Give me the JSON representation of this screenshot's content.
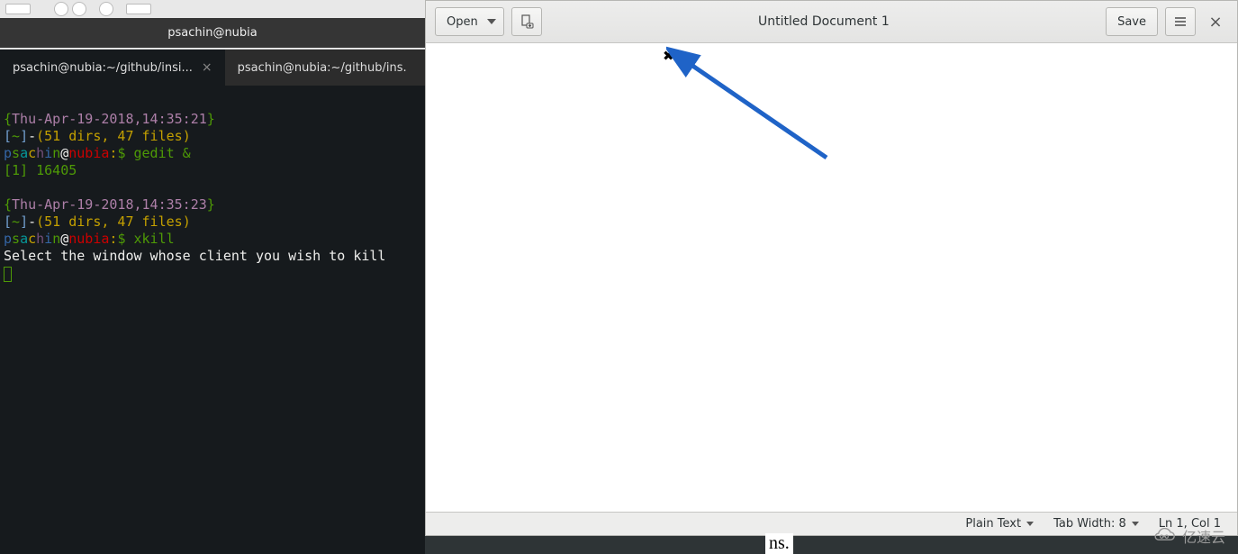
{
  "browser_fragment": {
    "title": "psachin@nubia"
  },
  "terminal": {
    "tabs": [
      {
        "label": "psachin@nubia:~/github/insi...",
        "active": true
      },
      {
        "label": "psachin@nubia:~/github/ins.",
        "active": false
      }
    ],
    "block1": {
      "timestamp": "Thu-Apr-19-2018,14:35:21",
      "stats": "51 dirs, 47 files",
      "host": "nubia",
      "command": "gedit &",
      "job": "[1]",
      "pid": "16405"
    },
    "block2": {
      "timestamp": "Thu-Apr-19-2018,14:35:23",
      "stats": "51 dirs, 47 files",
      "host": "nubia",
      "command": "xkill",
      "message": "Select the window whose client you wish to kill"
    }
  },
  "gedit": {
    "open_label": "Open",
    "save_label": "Save",
    "title": "Untitled Document 1",
    "status": {
      "language": "Plain Text",
      "tab_width": "Tab Width: 8",
      "position": "Ln 1, Col 1"
    }
  },
  "xkill_cursor_glyph": "✖",
  "stray": "ns.",
  "watermark_text": "亿速云"
}
